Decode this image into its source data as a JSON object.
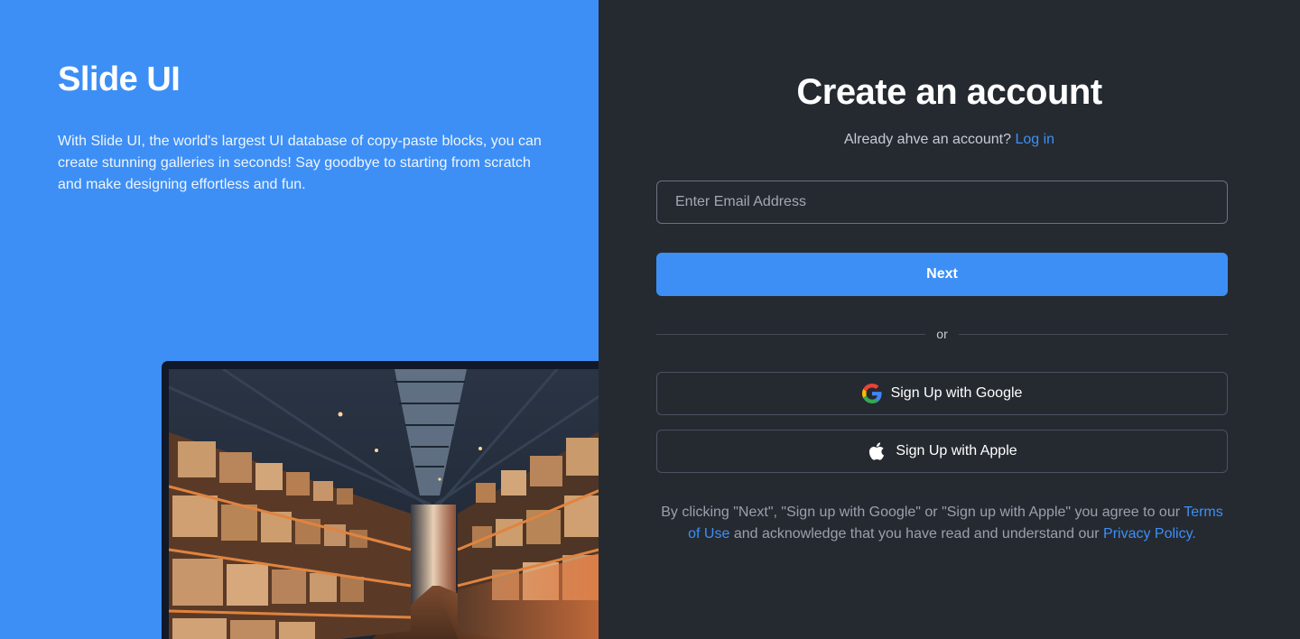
{
  "brand": {
    "name": "Slide UI",
    "tagline": "With Slide UI, the world's largest UI database of copy-paste blocks, you can create stunning galleries in seconds! Say goodbye to starting from scratch and make designing effortless and fun."
  },
  "signup": {
    "title": "Create an account",
    "login_prompt": "Already ahve an account?",
    "login_link": "Log in",
    "email_placeholder": "Enter Email Address",
    "email_value": "",
    "next_label": "Next",
    "divider_label": "or",
    "google_label": "Sign Up with Google",
    "apple_label": "Sign Up with Apple"
  },
  "legal": {
    "prefix": "By clicking \"Next\", \"Sign up with Google\" or \"Sign up with Apple\" you agree to our ",
    "terms_link": "Terms of Use",
    "middle": " and acknowledge that you have read and understand our ",
    "privacy_link": "Privacy Policy."
  },
  "icons": {
    "google": "google-logo-icon",
    "apple": "apple-logo-icon"
  },
  "colors": {
    "accent": "#3d8ff5",
    "left_background": "#3d8ff5",
    "right_background": "#252a31",
    "text_primary": "#ffffff",
    "text_muted": "#9aa1ab"
  }
}
